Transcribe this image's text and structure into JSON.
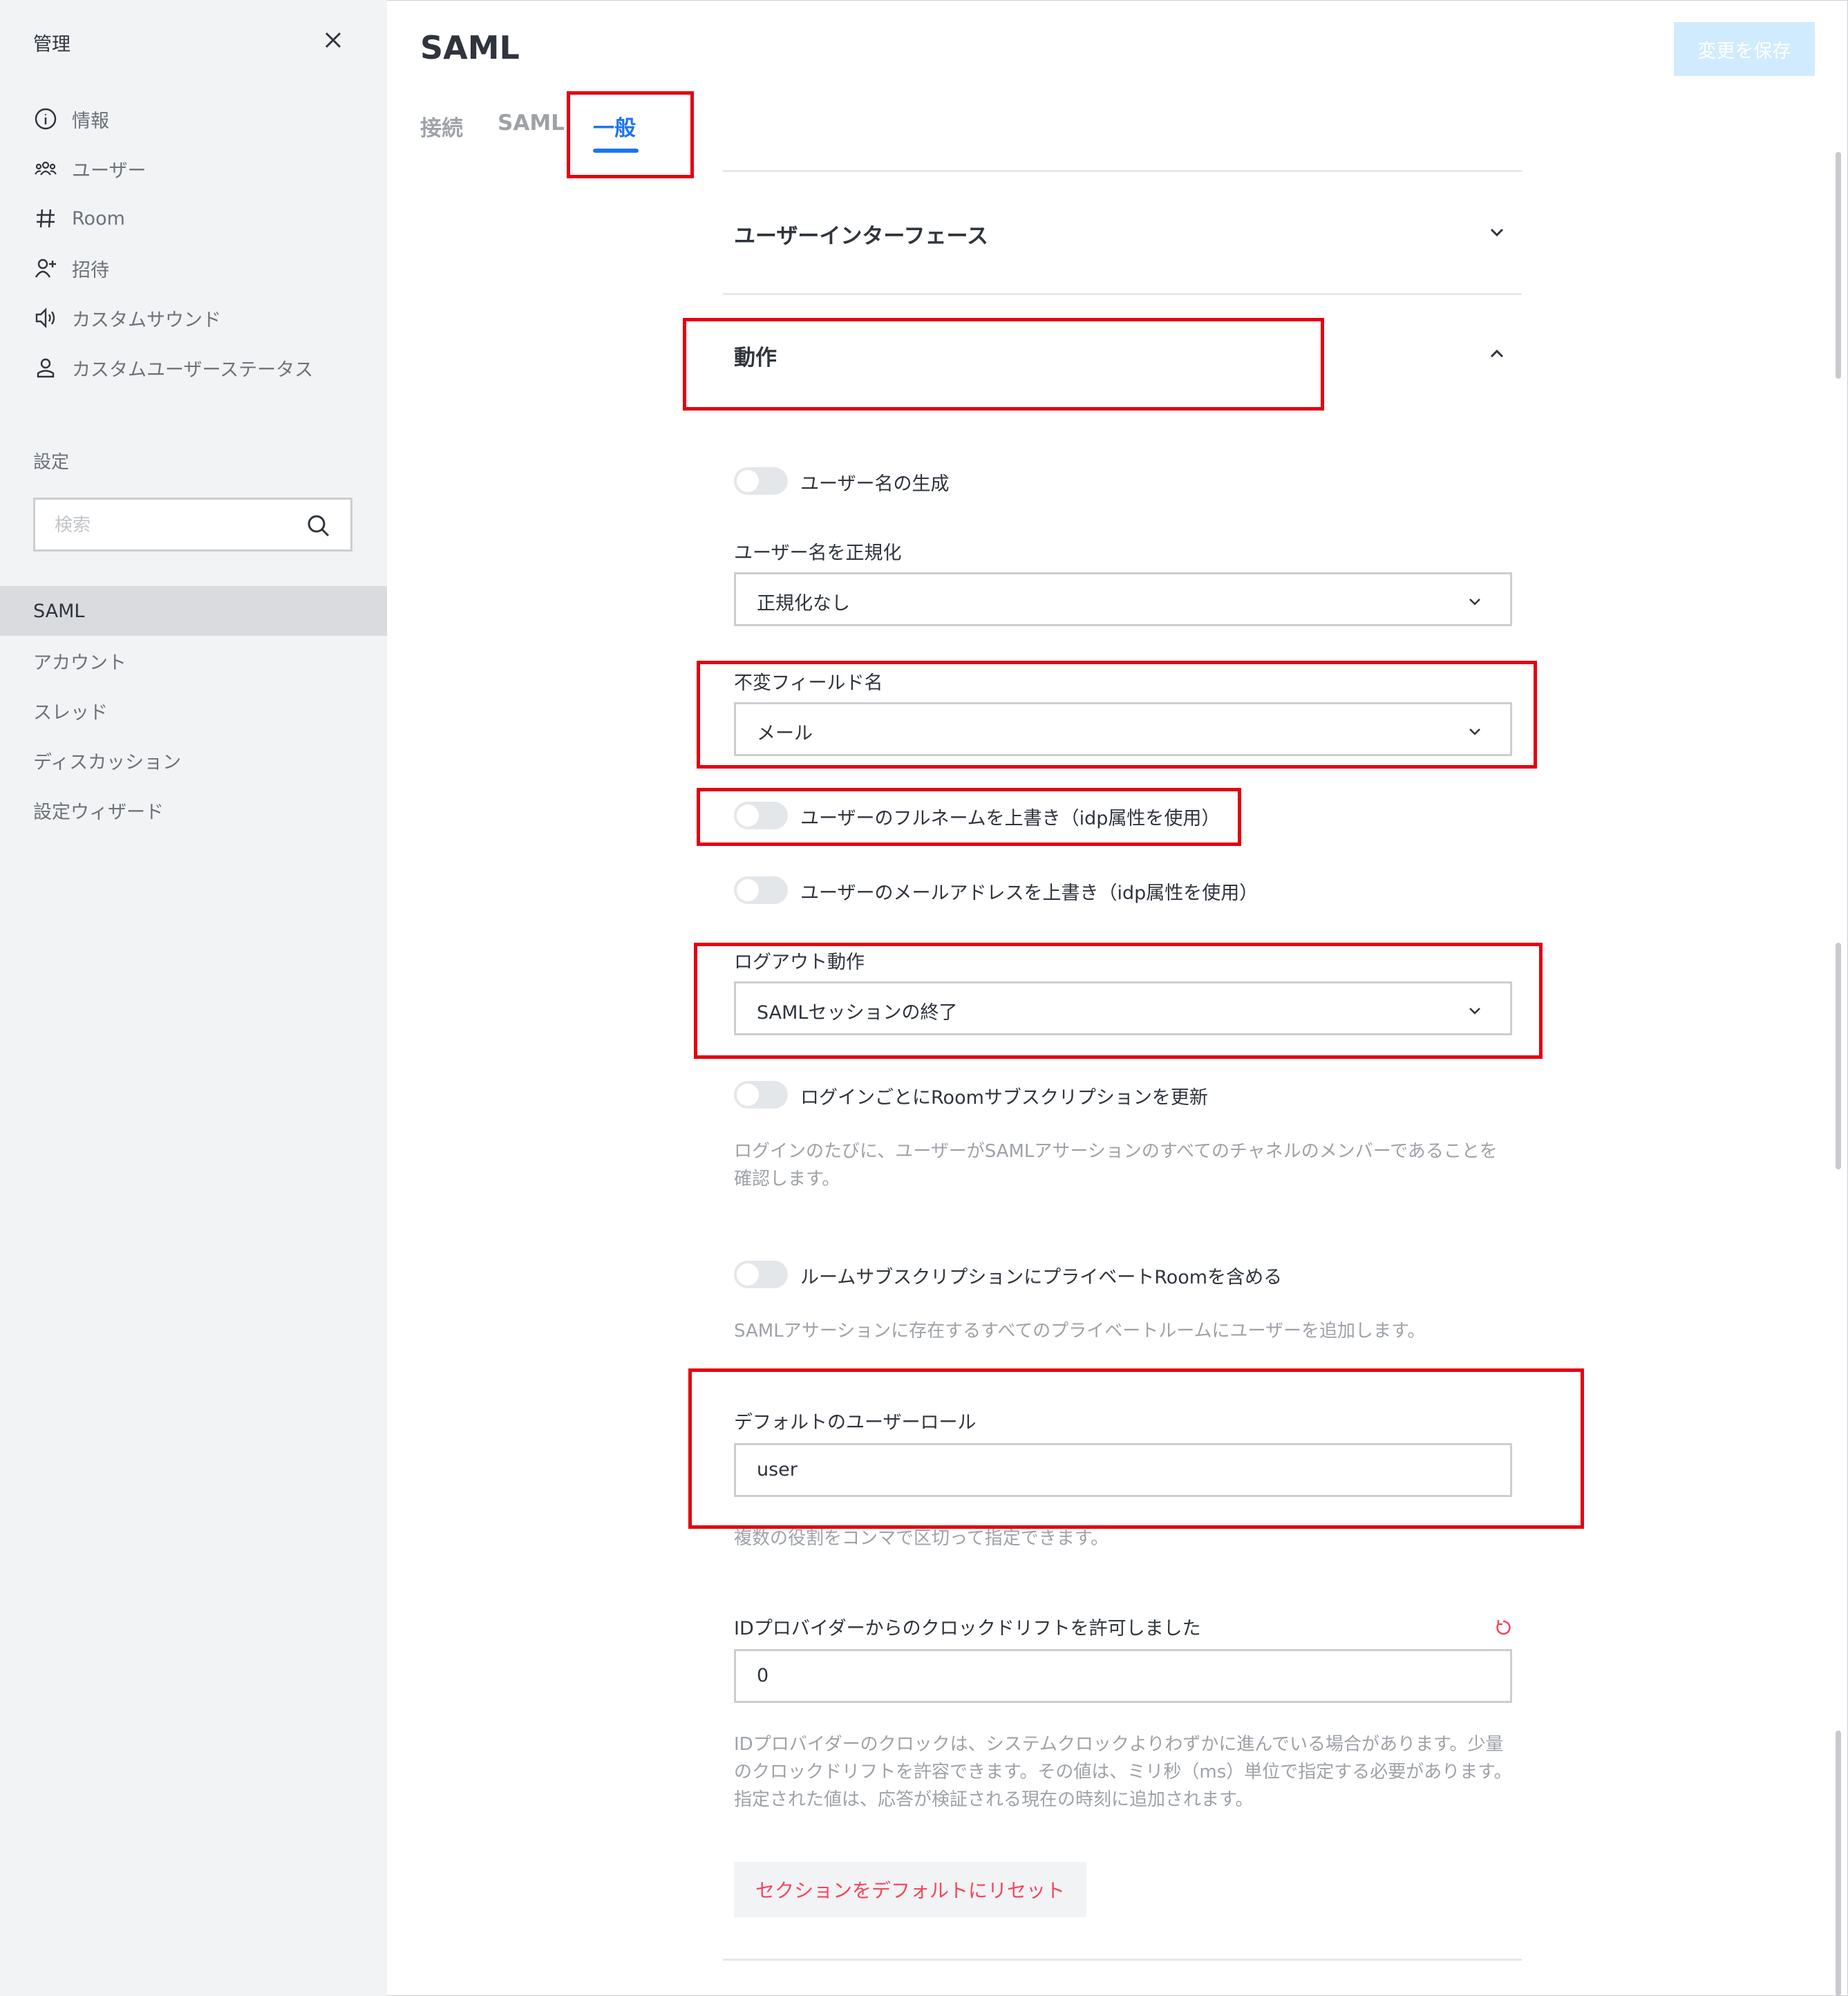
{
  "sidebar": {
    "title": "管理",
    "nav": [
      {
        "label": "情報",
        "icon": "info-icon"
      },
      {
        "label": "ユーザー",
        "icon": "users-icon"
      },
      {
        "label": "Room",
        "icon": "hash-icon"
      },
      {
        "label": "招待",
        "icon": "user-plus-icon"
      },
      {
        "label": "カスタムサウンド",
        "icon": "speaker-icon"
      },
      {
        "label": "カスタムユーザーステータス",
        "icon": "user-icon"
      }
    ],
    "settings_heading": "設定",
    "search_placeholder": "検索",
    "settings": [
      "SAML",
      "アカウント",
      "スレッド",
      "ディスカッション",
      "設定ウィザード"
    ],
    "active_setting": "SAML"
  },
  "header": {
    "title": "SAML",
    "save_label": "変更を保存"
  },
  "tabs": [
    {
      "label": "接続"
    },
    {
      "label": "SAML"
    },
    {
      "label": "一般",
      "active": true
    }
  ],
  "sections": {
    "ui": {
      "title": "ユーザーインターフェース",
      "expanded": false
    },
    "behavior": {
      "title": "動作",
      "expanded": true
    }
  },
  "fields": {
    "generate_username": {
      "label": "ユーザー名の生成",
      "enabled": false
    },
    "normalize_username": {
      "label": "ユーザー名を正規化",
      "value": "正規化なし"
    },
    "immutable_field": {
      "label": "不変フィールド名",
      "value": "メール"
    },
    "overwrite_fullname": {
      "label": "ユーザーのフルネームを上書き（idp属性を使用）",
      "enabled": false
    },
    "overwrite_email": {
      "label": "ユーザーのメールアドレスを上書き（idp属性を使用）",
      "enabled": false
    },
    "logout_behavior": {
      "label": "ログアウト動作",
      "value": "SAMLセッションの終了"
    },
    "update_room_subscriptions": {
      "label": "ログインごとにRoomサブスクリプションを更新",
      "enabled": false,
      "hint": "ログインのたびに、ユーザーがSAMLアサーションのすべてのチャネルのメンバーであることを確認します。"
    },
    "include_private_rooms": {
      "label": "ルームサブスクリプションにプライベートRoomを含める",
      "enabled": false,
      "hint": "SAMLアサーションに存在するすべてのプライベートルームにユーザーを追加します。"
    },
    "default_role": {
      "label": "デフォルトのユーザーロール",
      "value": "user",
      "hint": "複数の役割をコンマで区切って指定できます。"
    },
    "clock_drift": {
      "label": "IDプロバイダーからのクロックドリフトを許可しました",
      "value": "0",
      "hint": "IDプロバイダーのクロックは、システムクロックよりわずかに進んでいる場合があります。少量のクロックドリフトを許容できます。その値は、ミリ秒（ms）単位で指定する必要があります。指定された値は、応答が検証される現在の時刻に追加されます。"
    }
  },
  "reset_section_label": "セクションをデフォルトにリセット",
  "colors": {
    "accent": "#1d74f5",
    "highlight": "#e5000f",
    "danger_text": "#f5455c"
  }
}
